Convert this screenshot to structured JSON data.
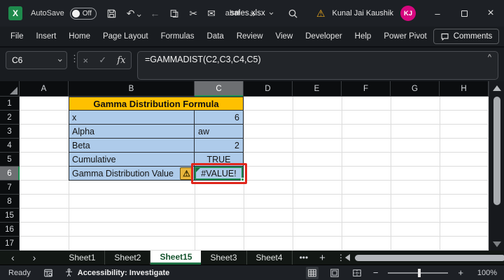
{
  "titlebar": {
    "logo_text": "X",
    "autosave_label": "AutoSave",
    "autosave_state": "Off",
    "filename": "sales.xlsx",
    "user_name": "Kunal Jai Kaushik",
    "user_initials": "KJ",
    "glyphs": {
      "undo": "↶",
      "back": "←",
      "cut": "✂",
      "email": "✉",
      "replace": "ab⇄",
      "more": "»",
      "warning": "⚠",
      "minimize": "–",
      "close": "×"
    }
  },
  "ribbon": {
    "tabs": [
      "File",
      "Insert",
      "Home",
      "Page Layout",
      "Formulas",
      "Data",
      "Review",
      "View",
      "Developer",
      "Help",
      "Power Pivot"
    ],
    "comments_label": "Comments"
  },
  "formula_bar": {
    "name_box": "C6",
    "cancel": "×",
    "enter": "✓",
    "fx": "fx",
    "formula": "=GAMMADIST(C2,C3,C4,C5)",
    "collapse": "^",
    "dots": "⋮"
  },
  "grid": {
    "columns": [
      "A",
      "B",
      "C",
      "D",
      "E",
      "F",
      "G",
      "H"
    ],
    "rows": [
      "1",
      "2",
      "3",
      "4",
      "5",
      "6",
      "7",
      "8",
      "15",
      "16",
      "17"
    ],
    "selected_column": "C",
    "selected_row": "6",
    "active_cell": "C6",
    "error_indicator": "⚠",
    "table": {
      "title": "Gamma Distribution Formula",
      "entries": [
        {
          "label": "x",
          "value": "6"
        },
        {
          "label": "Alpha",
          "value": "aw"
        },
        {
          "label": "Beta",
          "value": "2"
        },
        {
          "label": "Cumulative",
          "value": "TRUE"
        },
        {
          "label": "Gamma Distribution Value",
          "value": "#VALUE!"
        }
      ]
    },
    "colors": {
      "title_bg": "#FFC000",
      "cell_bg": "#AECBEA",
      "error_outline": "#E0261C",
      "selection_green": "#1E8E52"
    }
  },
  "sheet_bar": {
    "nav_left": "‹",
    "nav_right": "›",
    "tabs": [
      {
        "label": "Sheet1",
        "active": false
      },
      {
        "label": "Sheet2",
        "active": false
      },
      {
        "label": "Sheet15",
        "active": true
      },
      {
        "label": "Sheet3",
        "active": false
      },
      {
        "label": "Sheet4",
        "active": false
      }
    ],
    "more": "•••",
    "add": "+",
    "menu": "⋮"
  },
  "statusbar": {
    "mode": "Ready",
    "accessibility": "Accessibility: Investigate",
    "zoom_out": "−",
    "zoom_in": "+",
    "zoom_level": "100%"
  }
}
